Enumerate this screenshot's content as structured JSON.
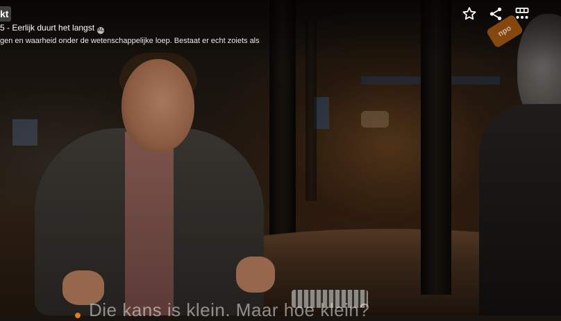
{
  "program": {
    "title_fragment": "kt",
    "episode": "5 - Eerlijk duurt het langst",
    "age_badge": "AL",
    "description": "gen en waarheid onder de wetenschappelijke loep. Bestaat er echt zoiets als"
  },
  "actions": {
    "favorite_icon": "star-icon",
    "share_icon": "share-icon",
    "more_icon": "grid-menu-icon"
  },
  "watermark": {
    "label": "npo",
    "color": "#e67814"
  },
  "subtitle": {
    "text": "Die kans is klein. Maar hoe klein?"
  }
}
